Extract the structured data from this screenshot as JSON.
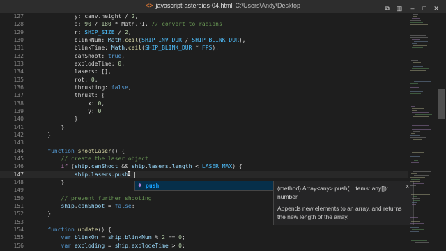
{
  "window": {
    "file_icon": "<>",
    "filename": "javascript-asteroids-04.html",
    "path": "C:\\Users\\Andy\\Desktop",
    "icons_left": [
      "layout-icon",
      "split-icon"
    ],
    "controls": [
      "minimize-icon",
      "maximize-icon",
      "close-icon"
    ]
  },
  "colors": {
    "background": "#1e1e1e",
    "keyword": "#569cd6",
    "control": "#c586c0",
    "function": "#dcdcaa",
    "variable": "#9cdcfe",
    "number": "#b5cea8",
    "constant": "#4fc1ff",
    "comment": "#6a9955",
    "suggest_selected": "#062f4a",
    "suggest_match": "#18a3ff"
  },
  "editor": {
    "current_line": 147,
    "lines": [
      {
        "n": "127",
        "t": [
          [
            "            ",
            ""
          ],
          [
            "y",
            ""
          ],
          [
            ": ",
            ""
          ],
          [
            "canv",
            ""
          ],
          [
            ".",
            ""
          ],
          [
            "height",
            ""
          ],
          [
            " / ",
            ""
          ],
          [
            "2",
            "num"
          ],
          [
            ",",
            ""
          ]
        ]
      },
      {
        "n": "128",
        "t": [
          [
            "            ",
            ""
          ],
          [
            "a",
            ""
          ],
          [
            ": ",
            ""
          ],
          [
            "90",
            "num"
          ],
          [
            " / ",
            ""
          ],
          [
            "180",
            "num"
          ],
          [
            " * ",
            ""
          ],
          [
            "Math",
            ""
          ],
          [
            ".",
            ""
          ],
          [
            "PI",
            ""
          ],
          [
            ", ",
            ""
          ],
          [
            "// convert to radians",
            "cmt"
          ]
        ]
      },
      {
        "n": "129",
        "t": [
          [
            "            ",
            ""
          ],
          [
            "r",
            ""
          ],
          [
            ": ",
            ""
          ],
          [
            "SHIP_SIZE",
            "cst"
          ],
          [
            " / ",
            ""
          ],
          [
            "2",
            "num"
          ],
          [
            ",",
            ""
          ]
        ]
      },
      {
        "n": "130",
        "t": [
          [
            "            ",
            ""
          ],
          [
            "blinkNum",
            ""
          ],
          [
            ": ",
            ""
          ],
          [
            "Math",
            "var"
          ],
          [
            ".",
            ""
          ],
          [
            "ceil",
            "fn"
          ],
          [
            "(",
            ""
          ],
          [
            "SHIP_INV_DUR",
            "cst"
          ],
          [
            " / ",
            ""
          ],
          [
            "SHIP_BLINK_DUR",
            "cst"
          ],
          [
            "),",
            ""
          ]
        ]
      },
      {
        "n": "131",
        "t": [
          [
            "            ",
            ""
          ],
          [
            "blinkTime",
            ""
          ],
          [
            ": ",
            ""
          ],
          [
            "Math",
            "var"
          ],
          [
            ".",
            ""
          ],
          [
            "ceil",
            "fn"
          ],
          [
            "(",
            ""
          ],
          [
            "SHIP_BLINK_DUR",
            "cst"
          ],
          [
            " * ",
            ""
          ],
          [
            "FPS",
            "cst"
          ],
          [
            "),",
            ""
          ]
        ]
      },
      {
        "n": "132",
        "t": [
          [
            "            ",
            ""
          ],
          [
            "canShoot",
            ""
          ],
          [
            ": ",
            ""
          ],
          [
            "true",
            "kw"
          ],
          [
            ",",
            ""
          ]
        ]
      },
      {
        "n": "133",
        "t": [
          [
            "            ",
            ""
          ],
          [
            "explodeTime",
            ""
          ],
          [
            ": ",
            ""
          ],
          [
            "0",
            "num"
          ],
          [
            ",",
            ""
          ]
        ]
      },
      {
        "n": "134",
        "t": [
          [
            "            ",
            ""
          ],
          [
            "lasers",
            ""
          ],
          [
            ": [],",
            ""
          ]
        ]
      },
      {
        "n": "135",
        "t": [
          [
            "            ",
            ""
          ],
          [
            "rot",
            ""
          ],
          [
            ": ",
            ""
          ],
          [
            "0",
            "num"
          ],
          [
            ",",
            ""
          ]
        ]
      },
      {
        "n": "136",
        "t": [
          [
            "            ",
            ""
          ],
          [
            "thrusting",
            ""
          ],
          [
            ": ",
            ""
          ],
          [
            "false",
            "kw"
          ],
          [
            ",",
            ""
          ]
        ]
      },
      {
        "n": "137",
        "t": [
          [
            "            ",
            ""
          ],
          [
            "thrust",
            ""
          ],
          [
            ": {",
            ""
          ]
        ]
      },
      {
        "n": "138",
        "t": [
          [
            "                ",
            ""
          ],
          [
            "x",
            ""
          ],
          [
            ": ",
            ""
          ],
          [
            "0",
            "num"
          ],
          [
            ",",
            ""
          ]
        ]
      },
      {
        "n": "139",
        "t": [
          [
            "                ",
            ""
          ],
          [
            "y",
            ""
          ],
          [
            ": ",
            ""
          ],
          [
            "0",
            "num"
          ]
        ]
      },
      {
        "n": "140",
        "t": [
          [
            "            }",
            ""
          ]
        ]
      },
      {
        "n": "141",
        "t": [
          [
            "        }",
            ""
          ]
        ]
      },
      {
        "n": "142",
        "t": [
          [
            "    }",
            ""
          ]
        ]
      },
      {
        "n": "143",
        "t": [
          [
            "",
            ""
          ]
        ]
      },
      {
        "n": "144",
        "t": [
          [
            "    ",
            ""
          ],
          [
            "function",
            "kw"
          ],
          [
            " ",
            ""
          ],
          [
            "shootLaser",
            "fn"
          ],
          [
            "() {",
            ""
          ]
        ]
      },
      {
        "n": "145",
        "t": [
          [
            "        ",
            ""
          ],
          [
            "// create the laser object",
            "cmt"
          ]
        ]
      },
      {
        "n": "146",
        "t": [
          [
            "        ",
            ""
          ],
          [
            "if",
            "ctl"
          ],
          [
            " (",
            ""
          ],
          [
            "ship",
            "var"
          ],
          [
            ".",
            ""
          ],
          [
            "canShoot",
            "var"
          ],
          [
            " && ",
            ""
          ],
          [
            "ship",
            "var"
          ],
          [
            ".",
            ""
          ],
          [
            "lasers",
            "var"
          ],
          [
            ".",
            ""
          ],
          [
            "length",
            "var"
          ],
          [
            " < ",
            ""
          ],
          [
            "LASER_MAX",
            "cst"
          ],
          [
            ") {",
            ""
          ]
        ]
      },
      {
        "n": "147",
        "t": [
          [
            "            ",
            ""
          ],
          [
            "ship",
            "var"
          ],
          [
            ".",
            ""
          ],
          [
            "lasers",
            "var"
          ],
          [
            ".",
            ""
          ],
          [
            "push",
            "var"
          ]
        ]
      },
      {
        "n": "148",
        "t": [
          [
            "        }",
            ""
          ]
        ]
      },
      {
        "n": "149",
        "t": [
          [
            "",
            ""
          ]
        ]
      },
      {
        "n": "150",
        "t": [
          [
            "        ",
            ""
          ],
          [
            "// prevent further shooting",
            "cmt"
          ]
        ]
      },
      {
        "n": "151",
        "t": [
          [
            "        ",
            ""
          ],
          [
            "ship",
            "var"
          ],
          [
            ".",
            ""
          ],
          [
            "canShoot",
            "var"
          ],
          [
            " = ",
            ""
          ],
          [
            "false",
            "kw"
          ],
          [
            ";",
            ""
          ]
        ]
      },
      {
        "n": "152",
        "t": [
          [
            "    }",
            ""
          ]
        ]
      },
      {
        "n": "153",
        "t": [
          [
            "",
            ""
          ]
        ]
      },
      {
        "n": "154",
        "t": [
          [
            "    ",
            ""
          ],
          [
            "function",
            "kw"
          ],
          [
            " ",
            ""
          ],
          [
            "update",
            "fn"
          ],
          [
            "() {",
            ""
          ]
        ]
      },
      {
        "n": "155",
        "t": [
          [
            "        ",
            ""
          ],
          [
            "var",
            "kw"
          ],
          [
            " ",
            ""
          ],
          [
            "blinkOn",
            "var"
          ],
          [
            " = ",
            ""
          ],
          [
            "ship",
            "var"
          ],
          [
            ".",
            ""
          ],
          [
            "blinkNum",
            "var"
          ],
          [
            " % ",
            ""
          ],
          [
            "2",
            "num"
          ],
          [
            " == ",
            ""
          ],
          [
            "0",
            "num"
          ],
          [
            ";",
            ""
          ]
        ]
      },
      {
        "n": "156",
        "t": [
          [
            "        ",
            ""
          ],
          [
            "var",
            "kw"
          ],
          [
            " ",
            ""
          ],
          [
            "exploding",
            "var"
          ],
          [
            " = ",
            ""
          ],
          [
            "ship",
            "var"
          ],
          [
            ".",
            ""
          ],
          [
            "explodeTime",
            "var"
          ],
          [
            " > ",
            ""
          ],
          [
            "0",
            "num"
          ],
          [
            ";",
            ""
          ]
        ]
      }
    ]
  },
  "suggest": {
    "icon": "method-icon",
    "glyph": "◆",
    "match": "push",
    "rest": ""
  },
  "details": {
    "signature": "(method) Array<any>.push(...items: any[]): number",
    "close": "×",
    "doc": "Appends new elements to an array, and returns the new length of the array."
  }
}
